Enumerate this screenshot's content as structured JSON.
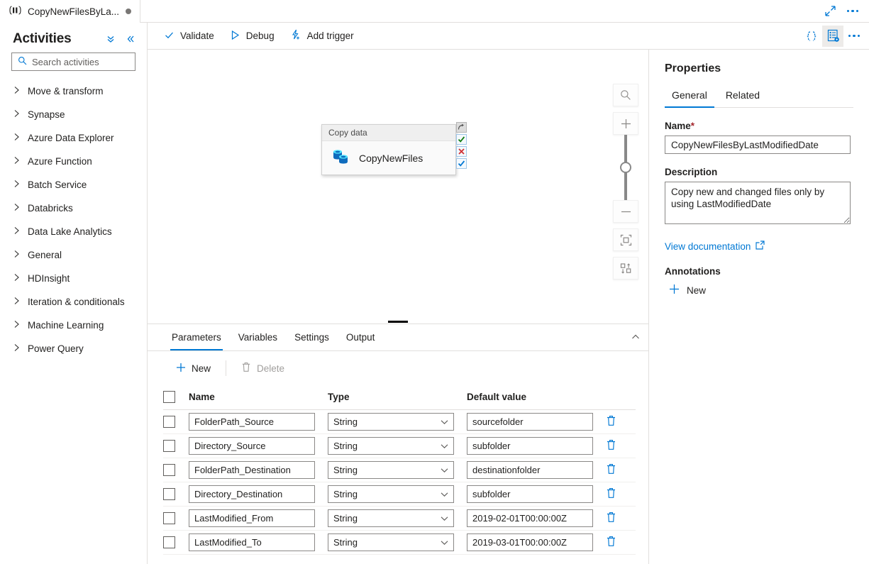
{
  "tab": {
    "icon": "pipeline-icon",
    "label": "CopyNewFilesByLa...",
    "dirty": true
  },
  "window_actions": {
    "expand_label": "expand-icon",
    "more_label": "more-icon"
  },
  "activities": {
    "title": "Activities",
    "collapse_all_icon": "double-chevron-down-icon",
    "collapse_panel_icon": "double-chevron-left-icon",
    "search": {
      "placeholder": "Search activities",
      "value": "",
      "icon": "search-icon"
    },
    "items": [
      {
        "label": "Move & transform"
      },
      {
        "label": "Synapse"
      },
      {
        "label": "Azure Data Explorer"
      },
      {
        "label": "Azure Function"
      },
      {
        "label": "Batch Service"
      },
      {
        "label": "Databricks"
      },
      {
        "label": "Data Lake Analytics"
      },
      {
        "label": "General"
      },
      {
        "label": "HDInsight"
      },
      {
        "label": "Iteration & conditionals"
      },
      {
        "label": "Machine Learning"
      },
      {
        "label": "Power Query"
      }
    ]
  },
  "toolbar": {
    "validate_label": "Validate",
    "debug_label": "Debug",
    "add_trigger_label": "Add trigger",
    "code_icon": "curly-braces-icon",
    "properties_icon": "properties-panel-icon",
    "more_icon": "more-icon"
  },
  "canvas": {
    "node": {
      "type_label": "Copy data",
      "name": "CopyNewFiles",
      "icon": "copy-data-icon",
      "connectors": [
        {
          "name": "skip-connector",
          "glyph": "↷",
          "color": "#555555"
        },
        {
          "name": "success-connector",
          "glyph": "✔",
          "color": "#107c10"
        },
        {
          "name": "failure-connector",
          "glyph": "✘",
          "color": "#d13438"
        },
        {
          "name": "completion-connector",
          "glyph": "✔",
          "color": "#0078d4"
        }
      ]
    },
    "zoom_controls": [
      {
        "name": "zoom-to-fit-search-icon",
        "glyph": "search"
      },
      {
        "name": "zoom-in-icon",
        "glyph": "plus"
      },
      {
        "name": "zoom-out-icon",
        "glyph": "minus"
      },
      {
        "name": "fit-to-screen-icon",
        "glyph": "fit"
      },
      {
        "name": "auto-align-icon",
        "glyph": "align"
      }
    ]
  },
  "bottom_panel": {
    "tabs": [
      {
        "label": "Parameters",
        "active": true
      },
      {
        "label": "Variables",
        "active": false
      },
      {
        "label": "Settings",
        "active": false
      },
      {
        "label": "Output",
        "active": false
      }
    ],
    "collapse_icon": "chevron-up-icon",
    "commands": {
      "new_label": "New",
      "delete_label": "Delete",
      "new_icon": "plus-icon",
      "delete_icon": "trash-icon"
    },
    "table": {
      "columns": [
        "Name",
        "Type",
        "Default value"
      ],
      "rows": [
        {
          "name": "FolderPath_Source",
          "type": "String",
          "value": "sourcefolder"
        },
        {
          "name": "Directory_Source",
          "type": "String",
          "value": "subfolder"
        },
        {
          "name": "FolderPath_Destination",
          "type": "String",
          "value": "destinationfolder"
        },
        {
          "name": "Directory_Destination",
          "type": "String",
          "value": "subfolder"
        },
        {
          "name": "LastModified_From",
          "type": "String",
          "value": "2019-02-01T00:00:00Z"
        },
        {
          "name": "LastModified_To",
          "type": "String",
          "value": "2019-03-01T00:00:00Z"
        }
      ]
    }
  },
  "properties": {
    "title": "Properties",
    "tabs": [
      {
        "label": "General",
        "active": true
      },
      {
        "label": "Related",
        "active": false
      }
    ],
    "name_label": "Name",
    "name_required": "*",
    "name_value": "CopyNewFilesByLastModifiedDate",
    "description_label": "Description",
    "description_value": "Copy new and changed files only by using LastModifiedDate",
    "doc_link_label": "View documentation",
    "doc_link_icon": "external-link-icon",
    "annotations_label": "Annotations",
    "annotation_new_label": "New",
    "annotation_new_icon": "plus-icon"
  },
  "colors": {
    "accent": "#0078d4",
    "success": "#107c10",
    "error": "#d13438",
    "required": "#a4262c",
    "panel_bg": "#f3f2f1",
    "border": "#e1dfdd"
  }
}
